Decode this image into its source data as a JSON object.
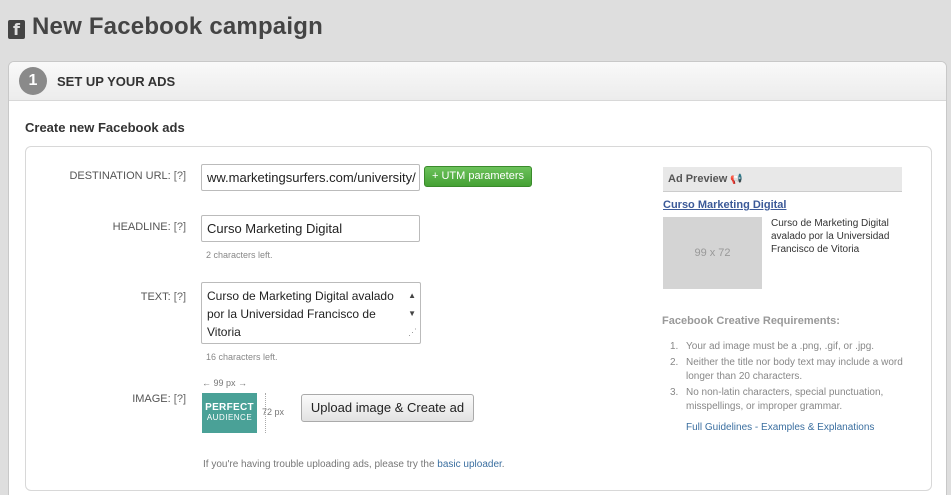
{
  "header": {
    "title": "New Facebook campaign",
    "icon": "facebook-icon"
  },
  "step": {
    "number": "1",
    "title": "SET UP YOUR ADS"
  },
  "section_title": "Create new Facebook ads",
  "form": {
    "destination": {
      "label": "DESTINATION URL:",
      "help": "[?]",
      "value": "ww.marketingsurfers.com/university/",
      "utm_button": "+ UTM parameters"
    },
    "headline": {
      "label": "HEADLINE:",
      "help": "[?]",
      "value": "Curso Marketing Digital",
      "hint": "2 characters left."
    },
    "text": {
      "label": "TEXT:",
      "help": "[?]",
      "value": "Curso de Marketing Digital avalado por la Universidad Francisco de Vitoria",
      "hint": "16 characters left."
    },
    "image": {
      "label": "IMAGE:",
      "help": "[?]",
      "width_label": "99 px",
      "height_label": "72 px",
      "thumb_line1": "PERFECT",
      "thumb_line2": "AUDIENCE",
      "upload_button": "Upload image & Create ad"
    },
    "trouble_text": "If you're having trouble uploading ads, please try the",
    "trouble_link": "basic uploader",
    "trouble_end": "."
  },
  "preview": {
    "header": "Ad Preview",
    "title": "Curso Marketing Digital",
    "image_placeholder": "99 x 72",
    "body": "Curso de Marketing Digital avalado por la Universidad Francisco de Vitoria"
  },
  "requirements": {
    "title": "Facebook Creative Requirements:",
    "items": [
      {
        "num": "1.",
        "text": "Your ad image must be a .png, .gif, or .jpg."
      },
      {
        "num": "2.",
        "text": "Neither the title nor body text may include a word longer than 20 characters."
      },
      {
        "num": "3.",
        "text": "No non-latin characters, special punctuation, misspellings, or improper grammar."
      }
    ],
    "guidelines_link": "Full Guidelines - Examples & Explanations"
  }
}
